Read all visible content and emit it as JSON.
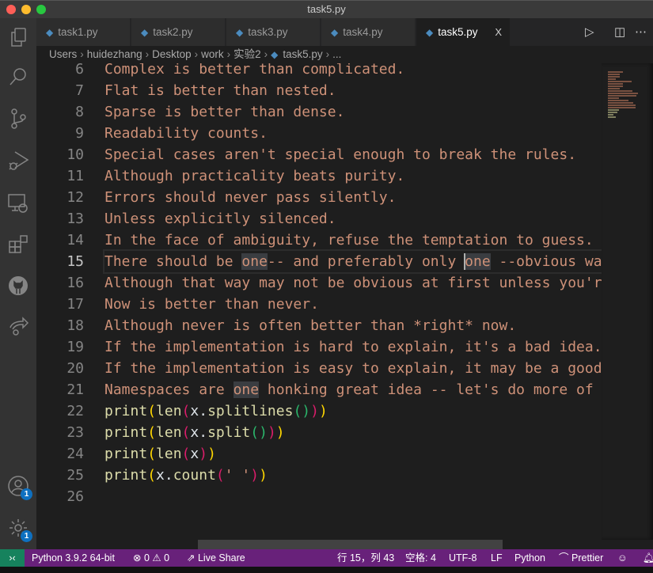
{
  "window": {
    "title": "task5.py"
  },
  "tabs": [
    {
      "label": "task1.py"
    },
    {
      "label": "task2.py"
    },
    {
      "label": "task3.py"
    },
    {
      "label": "task4.py"
    },
    {
      "label": "task5.py",
      "active": true
    }
  ],
  "tab_close": "X",
  "breadcrumb": [
    "Users",
    "huidezhang",
    "Desktop",
    "work",
    "实验2",
    "task5.py",
    "..."
  ],
  "activity_bar": {
    "items": [
      "explorer-icon",
      "search-icon",
      "source-control-icon",
      "run-debug-icon",
      "remote-explorer-icon",
      "extensions-icon",
      "github-icon",
      "live-share-icon"
    ],
    "accounts_badge": "1",
    "settings_badge": "1"
  },
  "editor": {
    "current_line": 15,
    "lines": [
      {
        "n": "6",
        "t": [
          [
            "Complex is better than complicated.",
            "s"
          ]
        ]
      },
      {
        "n": "7",
        "t": [
          [
            "Flat is better than nested.",
            "s"
          ]
        ]
      },
      {
        "n": "8",
        "t": [
          [
            "Sparse is better than dense.",
            "s"
          ]
        ]
      },
      {
        "n": "9",
        "t": [
          [
            "Readability counts.",
            "s"
          ]
        ]
      },
      {
        "n": "10",
        "t": [
          [
            "Special cases aren't special enough to break the rules.",
            "s"
          ]
        ]
      },
      {
        "n": "11",
        "t": [
          [
            "Although practicality beats purity.",
            "s"
          ]
        ]
      },
      {
        "n": "12",
        "t": [
          [
            "Errors should never pass silently.",
            "s"
          ]
        ]
      },
      {
        "n": "13",
        "t": [
          [
            "Unless explicitly silenced.",
            "s"
          ]
        ]
      },
      {
        "n": "14",
        "t": [
          [
            "In the face of ambiguity, refuse the temptation to guess.",
            "s"
          ]
        ]
      },
      {
        "n": "15",
        "t": [
          [
            "There should be ",
            "s"
          ],
          [
            "one",
            "s hl"
          ],
          [
            "-- and preferably only ",
            "s"
          ],
          [
            "one",
            "s hl"
          ],
          [
            " --obvious way to do it.",
            "s"
          ]
        ]
      },
      {
        "n": "16",
        "t": [
          [
            "Although that way may not be obvious at first unless you're Dutch.",
            "s"
          ]
        ]
      },
      {
        "n": "17",
        "t": [
          [
            "Now is better than never.",
            "s"
          ]
        ]
      },
      {
        "n": "18",
        "t": [
          [
            "Although never is often better than *right* now.",
            "s"
          ]
        ]
      },
      {
        "n": "19",
        "t": [
          [
            "If the implementation is hard to explain, it's a bad idea.",
            "s"
          ]
        ]
      },
      {
        "n": "20",
        "t": [
          [
            "If the implementation is easy to explain, it may be a good idea.",
            "s"
          ]
        ]
      },
      {
        "n": "21",
        "t": [
          [
            "Namespaces are ",
            "s"
          ],
          [
            "one",
            "s hl"
          ],
          [
            " honking great idea -- let's do more of those!",
            "s"
          ]
        ]
      },
      {
        "n": "22",
        "t": [
          [
            "print",
            "f"
          ],
          [
            "(",
            "b1"
          ],
          [
            "len",
            "f"
          ],
          [
            "(",
            "b2"
          ],
          [
            "x",
            "v"
          ],
          [
            ".",
            "v"
          ],
          [
            "splitlines",
            "f"
          ],
          [
            "(",
            "b3"
          ],
          [
            ")",
            "b3"
          ],
          [
            ")",
            "b2"
          ],
          [
            ")",
            "b1"
          ]
        ]
      },
      {
        "n": "23",
        "t": [
          [
            "print",
            "f"
          ],
          [
            "(",
            "b1"
          ],
          [
            "len",
            "f"
          ],
          [
            "(",
            "b2"
          ],
          [
            "x",
            "v"
          ],
          [
            ".",
            "v"
          ],
          [
            "split",
            "f"
          ],
          [
            "(",
            "b3"
          ],
          [
            ")",
            "b3"
          ],
          [
            ")",
            "b2"
          ],
          [
            ")",
            "b1"
          ]
        ]
      },
      {
        "n": "24",
        "t": [
          [
            "print",
            "f"
          ],
          [
            "(",
            "b1"
          ],
          [
            "len",
            "f"
          ],
          [
            "(",
            "b2"
          ],
          [
            "x",
            "v"
          ],
          [
            ")",
            "b2"
          ],
          [
            ")",
            "b1"
          ]
        ]
      },
      {
        "n": "25",
        "t": [
          [
            "print",
            "f"
          ],
          [
            "(",
            "b1"
          ],
          [
            "x",
            "v"
          ],
          [
            ".",
            "v"
          ],
          [
            "count",
            "f"
          ],
          [
            "(",
            "b2"
          ],
          [
            "' '",
            "s"
          ],
          [
            ")",
            "b2"
          ],
          [
            ")",
            "b1"
          ]
        ]
      },
      {
        "n": "26",
        "t": []
      }
    ]
  },
  "status": {
    "python": "Python 3.9.2 64-bit",
    "errors": "0",
    "warnings": "0",
    "live_share": "Live Share",
    "position": "行 15，列 43",
    "spaces": "空格: 4",
    "encoding": "UTF-8",
    "eol": "LF",
    "language": "Python",
    "prettier": "Prettier"
  },
  "colors": {
    "status_bar": "#68217a",
    "remote": "#16825d",
    "string": "#ce9178",
    "function": "#dcdcaa"
  }
}
